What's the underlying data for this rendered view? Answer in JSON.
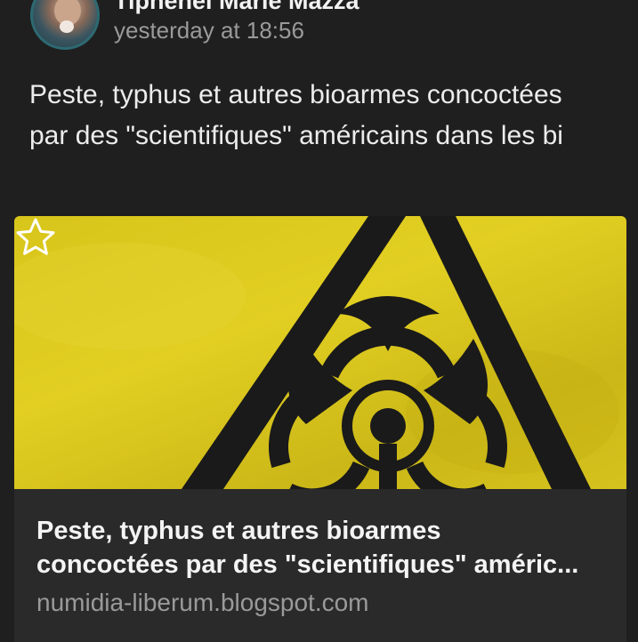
{
  "post": {
    "author": "Tiphenel Marie Mazza",
    "timestamp": "yesterday at 18:56",
    "text": "Peste, typhus et autres bioarmes concoctées par des \"scientifiques\" américains dans les bi"
  },
  "link_card": {
    "title_line_1": "Peste, typhus et autres bioarmes",
    "title_line_2": "concoctées par des \"scientifiques\" améric...",
    "domain": "numidia-liberum.blogspot.com",
    "image_icon": "biohazard-icon",
    "favorite_icon": "star-outline-icon"
  },
  "colors": {
    "background": "#1f1f1f",
    "card_background": "#2a2a2a",
    "image_yellow": "#d8c51b",
    "symbol_black": "#1a1a1a",
    "secondary_text": "#9a9a9a"
  }
}
